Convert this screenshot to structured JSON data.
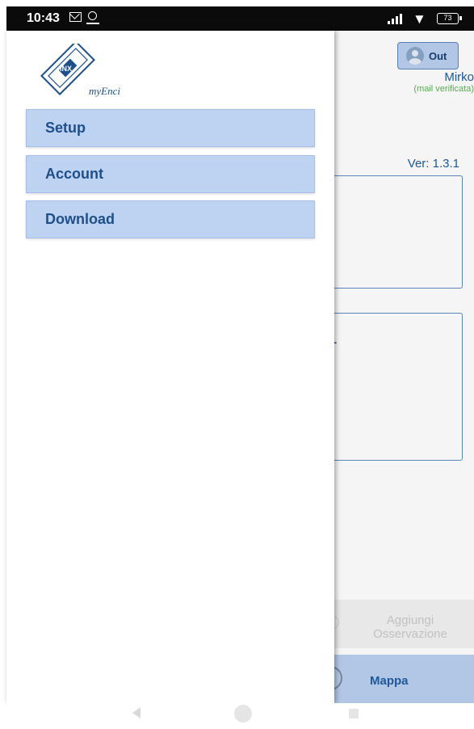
{
  "status_bar": {
    "time": "10:43",
    "icons": [
      "mail-icon",
      "location-icon",
      "signal-icon",
      "wifi-icon",
      "battery-icon"
    ],
    "battery": "73"
  },
  "drawer": {
    "logo_text": "myEnci",
    "logo_center": "INX",
    "menu": [
      {
        "label": "Setup"
      },
      {
        "label": "Account"
      },
      {
        "label": "Download"
      }
    ]
  },
  "app": {
    "logout_label": "Out",
    "user_name": "Mirko",
    "user_status": "(mail verificata)",
    "version": "Ver: 1.3.1",
    "card2_text": "a -",
    "add_observation_label": "Aggiungi Osservazione",
    "map_label": "Mappa"
  },
  "colors": {
    "accent_blue": "#1f5da0",
    "menu_bg": "#bed2f1",
    "verified_green": "#58b84e"
  }
}
